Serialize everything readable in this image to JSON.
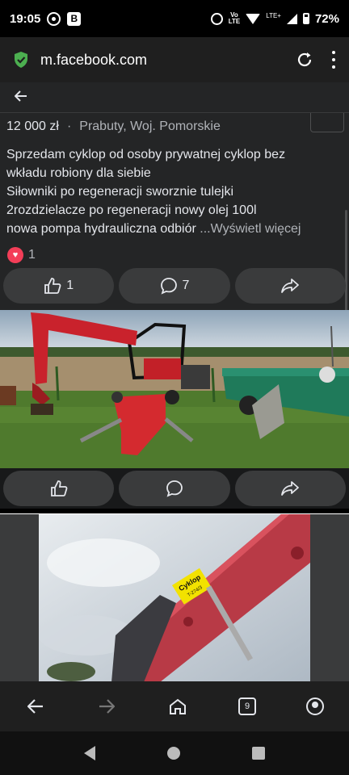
{
  "status_bar": {
    "time": "19:05",
    "volte_top": "Vo",
    "volte_bottom": "LTE",
    "lte": "LTE+",
    "battery": "72%"
  },
  "url_bar": {
    "url": "m.facebook.com"
  },
  "post": {
    "price": "12 000 zł",
    "separator": "·",
    "location": "Prabuty, Woj. Pomorskie",
    "description_lines": [
      "Sprzedam cyklop od osoby prywatnej cyklop bez",
      "wkładu robiony dla siebie",
      "Siłowniki po regeneracji sworznie tulejki",
      "2rozdzielacze po regeneracji nowy olej 100l",
      "nowa pompa hydrauliczna odbiór "
    ],
    "see_more": "...Wyświetl więcej",
    "reaction_count": "1",
    "like_count": "1",
    "comment_count": "7"
  },
  "photo2": {
    "sticker_line1": "Cyklop",
    "sticker_line2": "T-274/3"
  },
  "colors": {
    "fb_surface": "#242526",
    "fb_button": "#3a3b3c",
    "secure_green": "#4caf50",
    "heart_red": "#f33e58"
  },
  "icons": {
    "secure": "shield-check-icon",
    "reload": "reload-icon",
    "menu": "kebab-menu-icon",
    "back": "arrow-left-icon",
    "like": "thumbs-up-icon",
    "comment": "comment-bubble-icon",
    "share": "share-arrow-icon"
  },
  "browser_bar": {
    "tab_count": "9"
  }
}
